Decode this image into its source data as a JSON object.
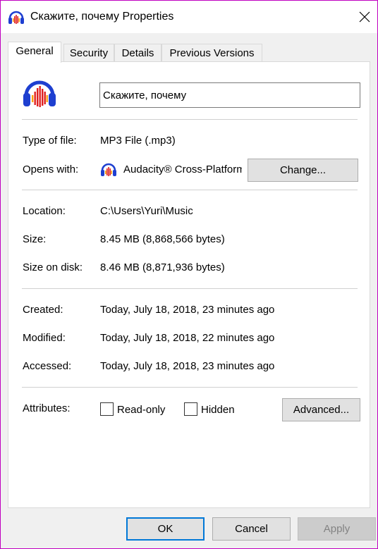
{
  "window": {
    "title": "Скажите, почему Properties",
    "icon": "audacity-headphones-icon",
    "close_glyph": "✕"
  },
  "tabs": [
    {
      "label": "General",
      "active": true
    },
    {
      "label": "Security",
      "active": false
    },
    {
      "label": "Details",
      "active": false
    },
    {
      "label": "Previous Versions",
      "active": false
    }
  ],
  "general": {
    "file_name": "Скажите, почему",
    "type_label": "Type of file:",
    "type_value": "MP3 File (.mp3)",
    "opens_label": "Opens with:",
    "opens_app": "Audacity® Cross-Platform Sound Editor",
    "change_label": "Change...",
    "location_label": "Location:",
    "location_value": "C:\\Users\\Yuri\\Music",
    "size_label": "Size:",
    "size_value": "8.45 MB (8,868,566 bytes)",
    "size_on_disk_label": "Size on disk:",
    "size_on_disk_value": "8.46 MB (8,871,936 bytes)",
    "created_label": "Created:",
    "created_value": "Today, July 18, 2018, 23 minutes ago",
    "modified_label": "Modified:",
    "modified_value": "Today, July 18, 2018, 22 minutes ago",
    "accessed_label": "Accessed:",
    "accessed_value": "Today, July 18, 2018, 23 minutes ago",
    "attributes_label": "Attributes:",
    "readonly_label": "Read-only",
    "readonly_checked": false,
    "hidden_label": "Hidden",
    "hidden_checked": false,
    "advanced_label": "Advanced..."
  },
  "footer": {
    "ok_label": "OK",
    "cancel_label": "Cancel",
    "apply_label": "Apply"
  },
  "colors": {
    "accent": "#0078d7",
    "headphone_blue": "#1e3fd0",
    "wave_red": "#e02020",
    "wave_orange": "#ff9a00"
  }
}
